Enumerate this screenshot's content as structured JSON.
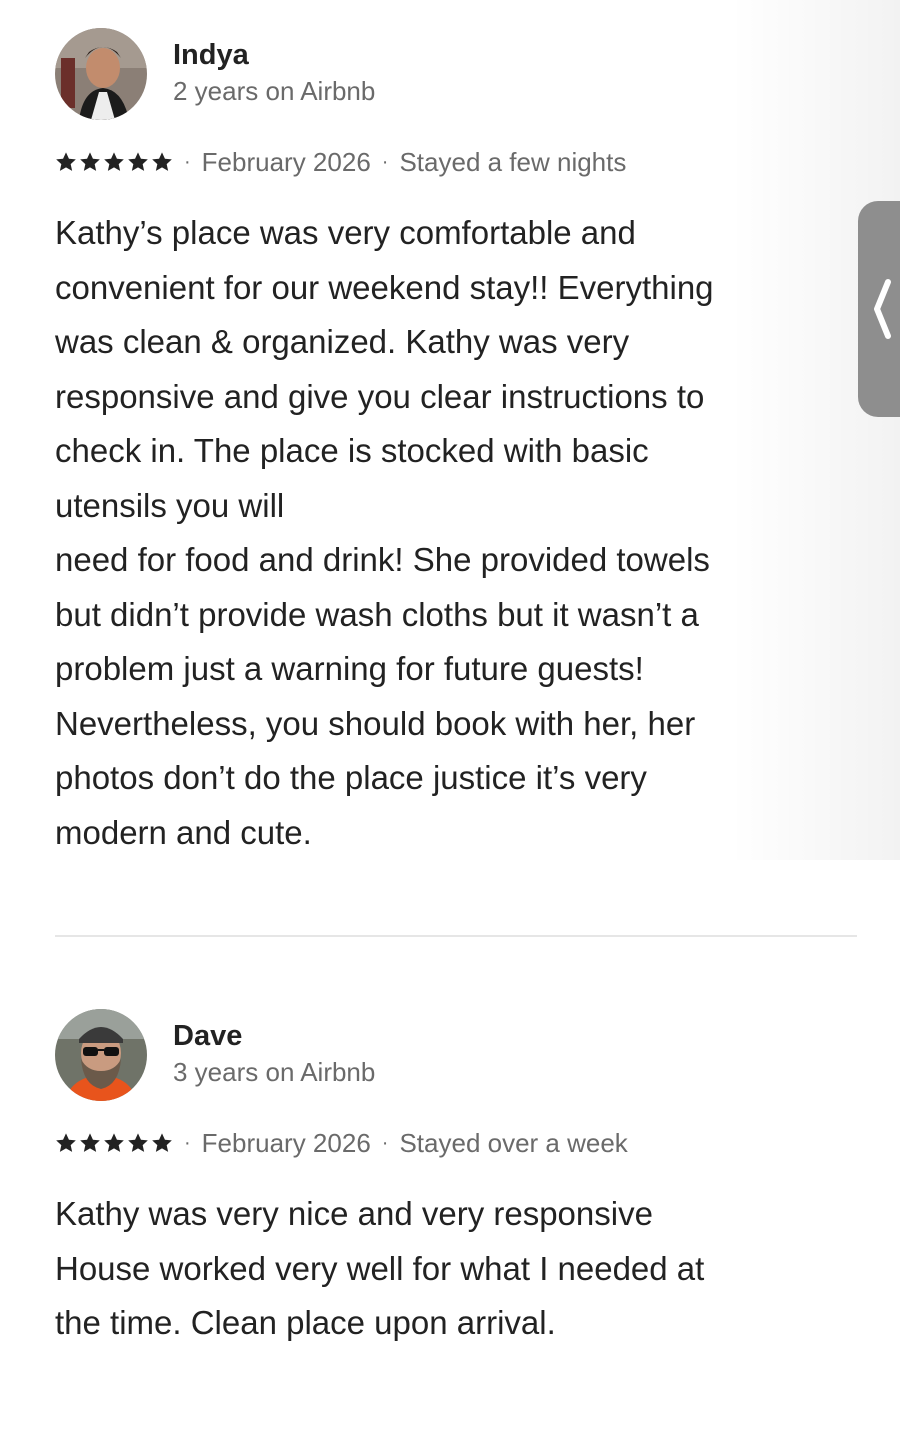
{
  "reviews": [
    {
      "name": "Indya",
      "tenure": "2 years on Airbnb",
      "rating": 5,
      "date": "February 2026",
      "stay": "Stayed a few nights",
      "text": "Kathy’s place was very comfortable and\nconvenient for our weekend stay!! Everything\nwas clean & organized. Kathy was very\nresponsive and give you clear instructions to\ncheck in. The place is stocked with basic\nutensils you will\nneed for food and drink! She provided towels\nbut didn’t provide wash cloths but it wasn’t a\nproblem just a warning for future guests!\nNevertheless, you should book with her, her\nphotos don’t do the place justice it’s very\nmodern and cute."
    },
    {
      "name": "Dave",
      "tenure": "3 years on Airbnb",
      "rating": 5,
      "date": "February 2026",
      "stay": "Stayed over a week",
      "text": "Kathy was very nice and very responsive\nHouse worked very well for what I needed at\nthe time.  Clean place upon arrival."
    }
  ],
  "separator": "·",
  "icons": {
    "star": "star-icon",
    "side_tab": "chevron-left-icon"
  },
  "colors": {
    "text": "#222222",
    "secondary": "#6a6a6a",
    "divider": "#e6e6e6",
    "side_tab": "#8e8e8e"
  }
}
